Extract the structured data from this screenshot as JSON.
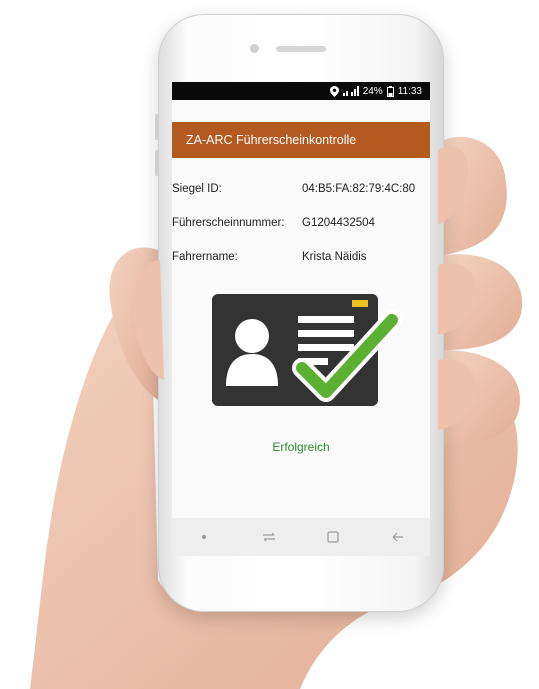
{
  "status_bar": {
    "battery": "24%",
    "time": "11:33"
  },
  "app": {
    "title": "ZA-ARC Führerscheinkontrolle"
  },
  "fields": [
    {
      "label": "Siegel ID:",
      "value": "04:B5:FA:82:79:4C:80"
    },
    {
      "label": "Führerscheinnummer:",
      "value": "G1204432504"
    },
    {
      "label": "Fahrername:",
      "value": "Krista Näidis"
    }
  ],
  "result": {
    "text": "Erfolgreich"
  },
  "colors": {
    "appbar": "#b45a21",
    "success": "#2f8b2f",
    "check": "#5cb031",
    "card": "#333333",
    "chip": "#f3c11f"
  },
  "icons": {
    "location": "location-pin-icon",
    "signal": "signal-icon",
    "battery": "battery-icon",
    "id_card": "id-card-icon",
    "check": "checkmark-icon",
    "nav_dot": "nav-dot-icon",
    "nav_recent": "recent-apps-icon",
    "nav_home": "home-icon",
    "nav_back": "back-icon"
  }
}
